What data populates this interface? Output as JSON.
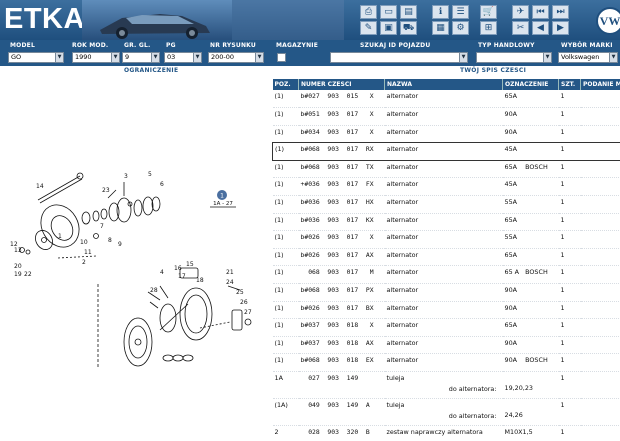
{
  "app": {
    "logo": "ETKA",
    "brand_logo_letters": "VW"
  },
  "toolbar_icons": [
    "print-icon",
    "display-icon",
    "image-icon",
    "info-icon",
    "edit-icon",
    "view-icon",
    "list-icon",
    "cart-icon",
    "pin-icon",
    "first-page-icon",
    "prev-page-icon",
    "next-page-icon",
    "last-page-icon"
  ],
  "filters": {
    "model": {
      "label": "MODEL",
      "value": "GO"
    },
    "rok_mod": {
      "label": "ROK MOD.",
      "value": "1990"
    },
    "gr_gl": {
      "label": "GR. GL.",
      "value": "9"
    },
    "pg": {
      "label": "PG",
      "value": "03"
    },
    "nr_rysunku": {
      "label": "NR RYSUNKU",
      "value": "200-00"
    },
    "magazynie": {
      "label": "MAGAZYNIE"
    },
    "szukaj": {
      "label": "SZUKAJ ID POJAZDU",
      "value": ""
    },
    "typ": {
      "label": "TYP HANDLOWY",
      "value": ""
    },
    "marka": {
      "label": "WYBÓR MARKI",
      "value": "Volkswagen"
    }
  },
  "subbar": {
    "left": "OGRANICZENIE",
    "right": "TWÓJ SPIS CZESCI"
  },
  "drawing": {
    "callout_number": "1",
    "callout_ref": "1A - 27",
    "labels": [
      "14",
      "23",
      "3",
      "5",
      "6",
      "7",
      "8",
      "9",
      "10",
      "11",
      "12",
      "13",
      "1",
      "19",
      "22",
      "20",
      "2",
      "4",
      "15",
      "16",
      "17",
      "18",
      "21",
      "24",
      "25",
      "26",
      "27",
      "28"
    ]
  },
  "table": {
    "headers": [
      "POZ.",
      "NUMER CZESCI",
      "NAZWA",
      "OZNACZENIE",
      "SZT.",
      "PODANIE MODELU"
    ],
    "rows": [
      {
        "poz": "(1)",
        "num": "b#027  903  015   X",
        "nazwa": "alternator",
        "ozn": "65A",
        "szt": "1"
      },
      {
        "poz": "(1)",
        "num": "b#051  903  017   X",
        "nazwa": "alternator",
        "ozn": "90A",
        "szt": "1"
      },
      {
        "poz": "(1)",
        "num": "b#034  903  017   X",
        "nazwa": "alternator",
        "ozn": "90A",
        "szt": "1"
      },
      {
        "poz": "(1)",
        "num": "b#068  903  017  RX",
        "nazwa": "alternator",
        "ozn": "45A",
        "szt": "1",
        "selected": true
      },
      {
        "poz": "(1)",
        "num": "b#068  903  017  TX",
        "nazwa": "alternator",
        "ozn": "65A    BOSCH",
        "szt": "1"
      },
      {
        "poz": "(1)",
        "num": "+#036  903  017  FX",
        "nazwa": "alternator",
        "ozn": "45A",
        "szt": "1"
      },
      {
        "poz": "(1)",
        "num": "b#036  903  017  HX",
        "nazwa": "alternator",
        "ozn": "55A",
        "szt": "1"
      },
      {
        "poz": "(1)",
        "num": "b#036  903  017  KX",
        "nazwa": "alternator",
        "ozn": "65A",
        "szt": "1"
      },
      {
        "poz": "(1)",
        "num": "b#026  903  017   X",
        "nazwa": "alternator",
        "ozn": "55A",
        "szt": "1"
      },
      {
        "poz": "(1)",
        "num": "b#026  903  017  AX",
        "nazwa": "alternator",
        "ozn": "65A",
        "szt": "1"
      },
      {
        "poz": "(1)",
        "num": "  068  903  017   M",
        "nazwa": "alternator",
        "ozn": "65 A   BOSCH",
        "szt": "1"
      },
      {
        "poz": "(1)",
        "num": "b#068  903  017  PX",
        "nazwa": "alternator",
        "ozn": "90A",
        "szt": "1"
      },
      {
        "poz": "(1)",
        "num": "b#026  903  017  BX",
        "nazwa": "alternator",
        "ozn": "90A",
        "szt": "1"
      },
      {
        "poz": "(1)",
        "num": "b#037  903  018   X",
        "nazwa": "alternator",
        "ozn": "65A",
        "szt": "1"
      },
      {
        "poz": "(1)",
        "num": "b#037  903  018  AX",
        "nazwa": "alternator",
        "ozn": "90A",
        "szt": "1"
      },
      {
        "poz": "(1)",
        "num": "b#068  903  018  EX",
        "nazwa": "alternator",
        "ozn": "90A    BOSCH",
        "szt": "1"
      },
      {
        "poz": "1A",
        "num": "  027  903  149",
        "nazwa": "tuleja",
        "note": "do alternatora:",
        "ozn": "19,20,23",
        "szt": "1",
        "tall": true
      },
      {
        "poz": "(1A)",
        "num": "  049  903  149  A",
        "nazwa": "tuleja",
        "note": "do alternatora:",
        "ozn": "24,26",
        "szt": "1",
        "tall": true
      },
      {
        "poz": "2",
        "num": "  028  903  320  B",
        "nazwa": "zestaw naprawczy alternatora",
        "ozn": "M10X1,5",
        "szt": "1"
      }
    ]
  }
}
